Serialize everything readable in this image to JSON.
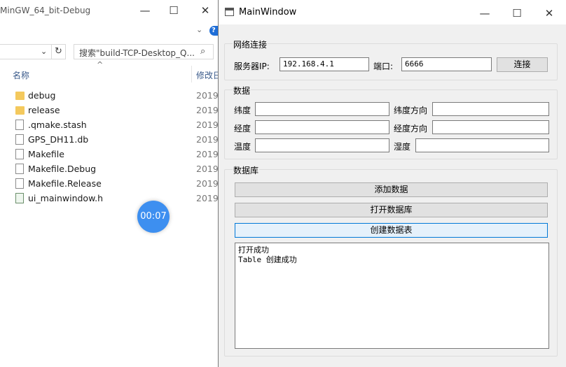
{
  "explorer": {
    "title": "MinGW_64_bit-Debug",
    "controls": {
      "minimize": "—",
      "maximize": "☐",
      "close": "✕"
    },
    "refresh_icon": "↻",
    "search_placeholder": "搜索\"build-TCP-Desktop_Q...",
    "search_icon": "⌕",
    "help_icon": "?",
    "columns": {
      "name": "名称",
      "date": "修改日"
    },
    "files": [
      {
        "name": "debug",
        "type": "folder",
        "date": "2019/"
      },
      {
        "name": "release",
        "type": "folder",
        "date": "2019/"
      },
      {
        "name": ".qmake.stash",
        "type": "doc",
        "date": "2019/"
      },
      {
        "name": "GPS_DH11.db",
        "type": "doc",
        "date": "2019/"
      },
      {
        "name": "Makefile",
        "type": "doc",
        "date": "2019/"
      },
      {
        "name": "Makefile.Debug",
        "type": "doc",
        "date": "2019/"
      },
      {
        "name": "Makefile.Release",
        "type": "doc",
        "date": "2019/"
      },
      {
        "name": "ui_mainwindow.h",
        "type": "header",
        "date": "2019/"
      }
    ]
  },
  "timer": {
    "text": "00:07"
  },
  "mainwindow": {
    "title": "MainWindow",
    "controls": {
      "minimize": "—",
      "maximize": "☐",
      "close": "✕"
    },
    "network": {
      "group_title": "网络连接",
      "server_ip_label": "服务器IP:",
      "server_ip_value": "192.168.4.1",
      "port_label": "端口:",
      "port_value": "6666",
      "connect_button": "连接"
    },
    "data": {
      "group_title": "数据",
      "latitude_label": "纬度",
      "latitude_value": "",
      "lat_direction_label": "纬度方向",
      "lat_direction_value": "",
      "longitude_label": "经度",
      "longitude_value": "",
      "lon_direction_label": "经度方向",
      "lon_direction_value": "",
      "temperature_label": "温度",
      "temperature_value": "",
      "humidity_label": "湿度",
      "humidity_value": ""
    },
    "database": {
      "group_title": "数据库",
      "add_data_button": "添加数据",
      "open_db_button": "打开数据库",
      "create_table_button": "创建数据表",
      "log_lines": [
        "打开成功",
        "Table 创建成功"
      ]
    }
  }
}
